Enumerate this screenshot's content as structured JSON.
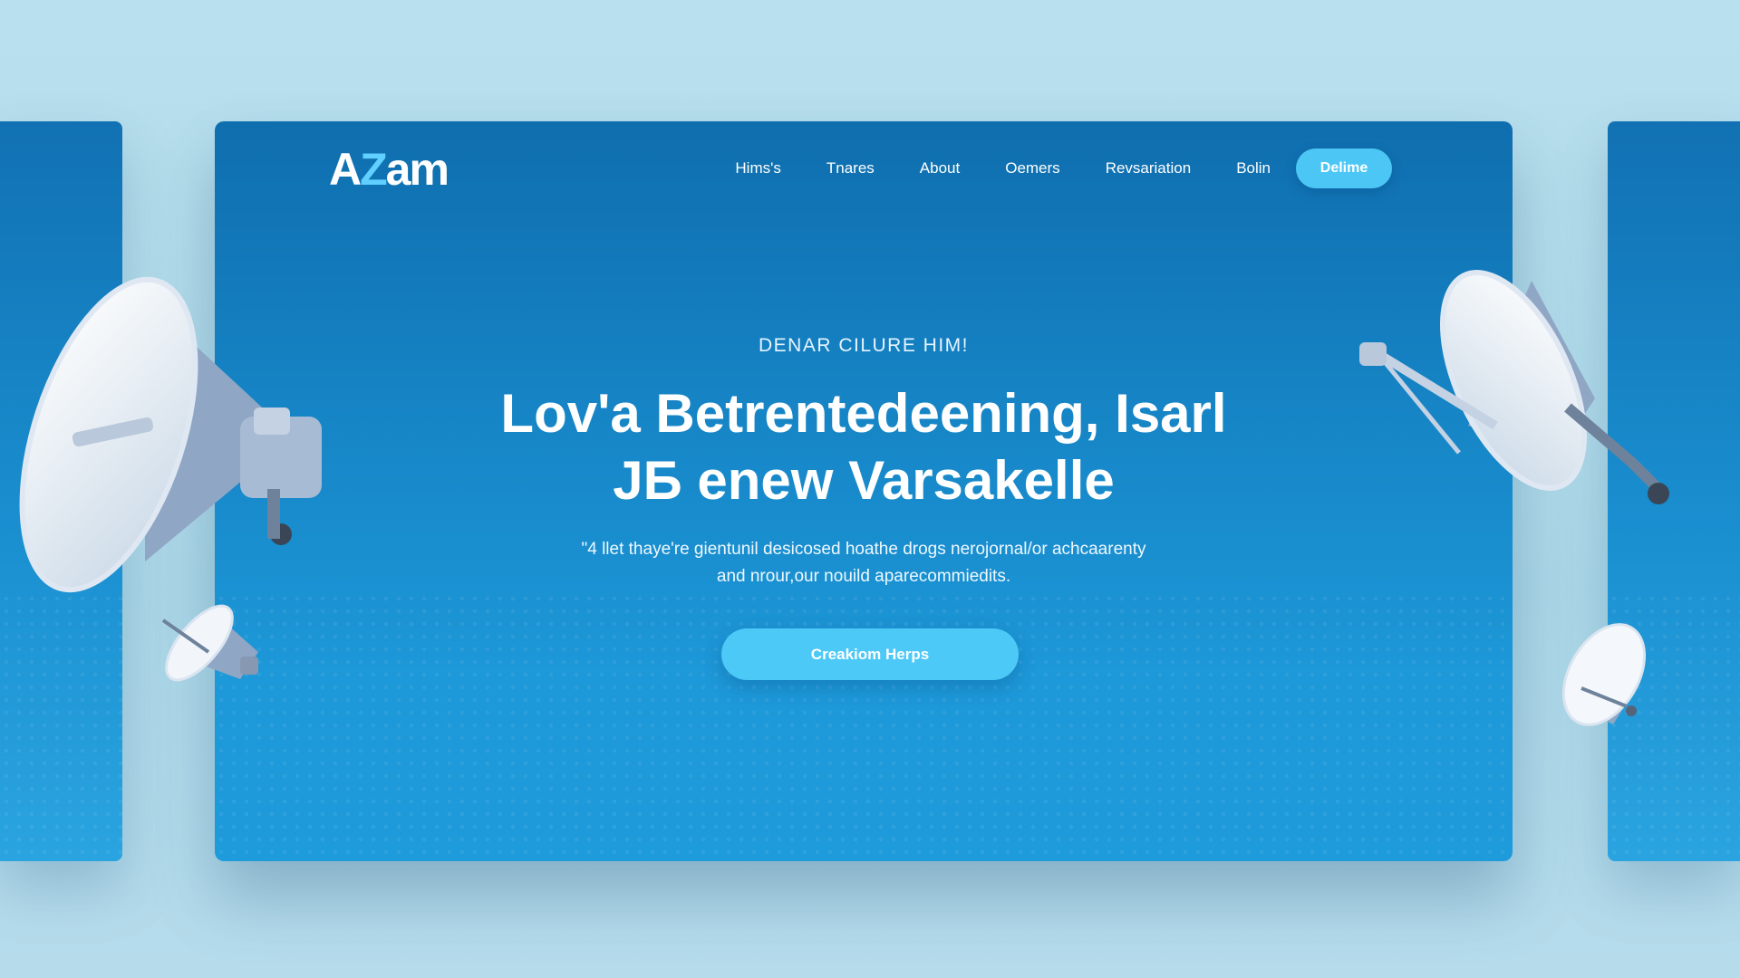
{
  "brand": {
    "logo_text_a": "A",
    "logo_text_z": "Z",
    "logo_text_rest": "am"
  },
  "nav": {
    "items": [
      {
        "label": "Hims's"
      },
      {
        "label": "Tnares"
      },
      {
        "label": "About"
      },
      {
        "label": "Oemers"
      },
      {
        "label": "Revsariation"
      },
      {
        "label": "Bolin"
      }
    ],
    "cta_label": "Delime"
  },
  "hero": {
    "eyebrow": "DENAR CILURE HIM!",
    "headline_line1": "Lov'a Betrentedeening, Isarl",
    "headline_line2": "JБ enew Varsakelle",
    "subtitle_line1": "\"4 llet thaye're gientunil desicosed hoathe drogs nerojornal/or achcaarenty",
    "subtitle_line2": "and nrour,our nouild aparecommiedits.",
    "cta_label": "Creakiom Herps"
  },
  "colors": {
    "page_background": "#b0dcea",
    "panel_top": "#0f6eae",
    "panel_bottom": "#1e9bdb",
    "button": "#4cc7f5",
    "text": "#ffffff"
  },
  "icons": [
    "satellite-dish-icon"
  ]
}
